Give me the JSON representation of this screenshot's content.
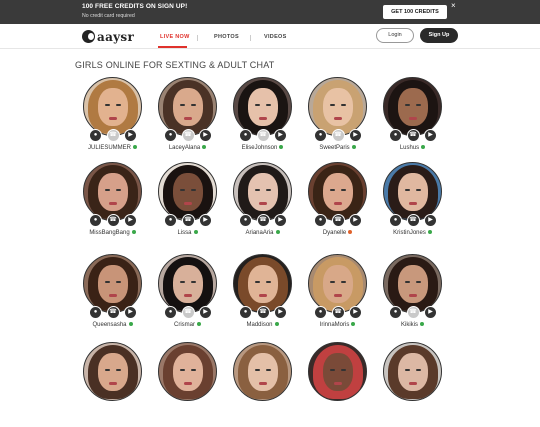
{
  "promo": {
    "headline": "100 FREE CREDITS ON SIGN UP!",
    "subline": "No credit card required",
    "cta": "GET 100 CREDITS",
    "close": "×"
  },
  "nav": {
    "logo": "aaysr",
    "links": [
      "LIVE NOW",
      "PHOTOS",
      "VIDEOS"
    ],
    "active": "LIVE NOW",
    "login": "Login",
    "signup": "Sign Up"
  },
  "heading": "GIRLS ONLINE FOR SEXTING & ADULT CHAT",
  "colors": {
    "accent": "#e0322c",
    "online": "#3aa84a",
    "away": "#e0622c"
  },
  "models": [
    {
      "name": "JULIESUMMER",
      "status": "online",
      "phone_enabled": false,
      "skin": "#e2b28f",
      "hair": "#b07a42",
      "bg": "#d9c2a9"
    },
    {
      "name": "LaceyAlana",
      "status": "online",
      "phone_enabled": false,
      "skin": "#d9a98c",
      "hair": "#4a3226",
      "bg": "#9a8373"
    },
    {
      "name": "EliseJohnson",
      "status": "online",
      "phone_enabled": false,
      "skin": "#e6c1aa",
      "hair": "#1a1412",
      "bg": "#5a4a46"
    },
    {
      "name": "SweetParis",
      "status": "online",
      "phone_enabled": false,
      "skin": "#e8c2a4",
      "hair": "#c9a272",
      "bg": "#b8a898"
    },
    {
      "name": "Lushus",
      "status": "online",
      "phone_enabled": true,
      "skin": "#9c6a4e",
      "hair": "#1c1412",
      "bg": "#3a2a28"
    },
    {
      "name": "MissBangBang",
      "status": "online",
      "phone_enabled": true,
      "skin": "#d6a08a",
      "hair": "#3a2418",
      "bg": "#7a5648"
    },
    {
      "name": "Lissa",
      "status": "online",
      "phone_enabled": true,
      "skin": "#7a4e3a",
      "hair": "#1a1210",
      "bg": "#e4dcd4"
    },
    {
      "name": "ArianaAria",
      "status": "online",
      "phone_enabled": true,
      "skin": "#e4c2b0",
      "hair": "#201a18",
      "bg": "#c8c0bc"
    },
    {
      "name": "Dyanelle",
      "status": "away",
      "phone_enabled": true,
      "skin": "#dca88e",
      "hair": "#3a2416",
      "bg": "#6a4030"
    },
    {
      "name": "KristinJones",
      "status": "online",
      "phone_enabled": true,
      "skin": "#e0b8a0",
      "hair": "#2a1c18",
      "bg": "#4a7aa8"
    },
    {
      "name": "Queensasha",
      "status": "online",
      "phone_enabled": true,
      "skin": "#c89478",
      "hair": "#3a2216",
      "bg": "#8a6a58"
    },
    {
      "name": "Crismar",
      "status": "online",
      "phone_enabled": false,
      "skin": "#d8b09a",
      "hair": "#141010",
      "bg": "#b8a8a0"
    },
    {
      "name": "Maddison",
      "status": "online",
      "phone_enabled": true,
      "skin": "#e0b496",
      "hair": "#7a4a2a",
      "bg": "#24201e"
    },
    {
      "name": "IrinnaMoris",
      "status": "online",
      "phone_enabled": true,
      "skin": "#d8a888",
      "hair": "#c89a64",
      "bg": "#a88a70"
    },
    {
      "name": "Kikikis",
      "status": "online",
      "phone_enabled": false,
      "skin": "#c8987c",
      "hair": "#2a1a14",
      "bg": "#7a6a60"
    },
    {
      "name": "",
      "status": "",
      "phone_enabled": false,
      "skin": "#d8a88c",
      "hair": "#4a3024",
      "bg": "#c8b4a8"
    },
    {
      "name": "",
      "status": "",
      "phone_enabled": false,
      "skin": "#e0b29a",
      "hair": "#6a4030",
      "bg": "#9a7868"
    },
    {
      "name": "",
      "status": "",
      "phone_enabled": false,
      "skin": "#e4c0a8",
      "hair": "#8a6040",
      "bg": "#b89880"
    },
    {
      "name": "",
      "status": "",
      "phone_enabled": false,
      "skin": "#7a4a38",
      "hair": "#c04040",
      "bg": "#3a2a28"
    },
    {
      "name": "",
      "status": "",
      "phone_enabled": false,
      "skin": "#dcb8a4",
      "hair": "#5a3a2a",
      "bg": "#c8c4c0"
    }
  ]
}
